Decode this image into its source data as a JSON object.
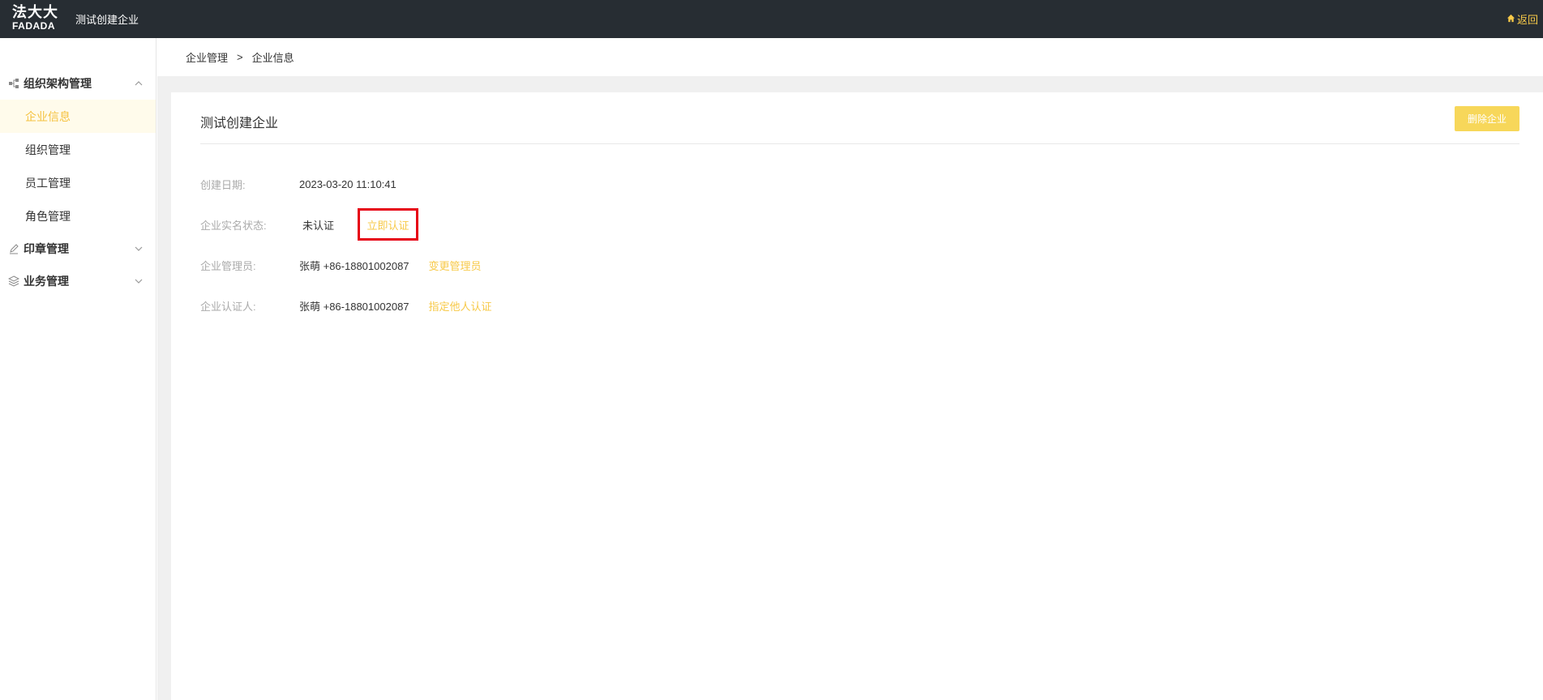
{
  "header": {
    "logo_cn": "法大大",
    "logo_en": "FADADA",
    "app_title": "测试创建企业",
    "back_label": "返回"
  },
  "sidebar": {
    "groups": [
      {
        "label": "组织架构管理",
        "icon": "org-tree-icon",
        "expanded": true,
        "items": [
          {
            "label": "企业信息",
            "active": true
          },
          {
            "label": "组织管理",
            "active": false
          },
          {
            "label": "员工管理",
            "active": false
          },
          {
            "label": "角色管理",
            "active": false
          }
        ]
      },
      {
        "label": "印章管理",
        "icon": "pen-icon",
        "expanded": false
      },
      {
        "label": "业务管理",
        "icon": "layers-icon",
        "expanded": false
      }
    ]
  },
  "breadcrumb": {
    "root": "企业管理",
    "separator": ">",
    "current": "企业信息"
  },
  "main": {
    "title": "测试创建企业",
    "delete_button": "删除企业",
    "fields": {
      "created_label": "创建日期:",
      "created_value": "2023-03-20 11:10:41",
      "status_label": "企业实名状态:",
      "status_value": "未认证",
      "status_action": "立即认证",
      "admin_label": "企业管理员:",
      "admin_value": "张萌 +86-18801002087",
      "admin_action": "变更管理员",
      "certifier_label": "企业认证人:",
      "certifier_value": "张萌 +86-18801002087",
      "certifier_action": "指定他人认证"
    }
  },
  "colors": {
    "header_bg": "#272d33",
    "accent": "#f7c948",
    "button_bg": "#f7d75a",
    "active_bg": "#fffbeb",
    "highlight": "#e60012"
  }
}
